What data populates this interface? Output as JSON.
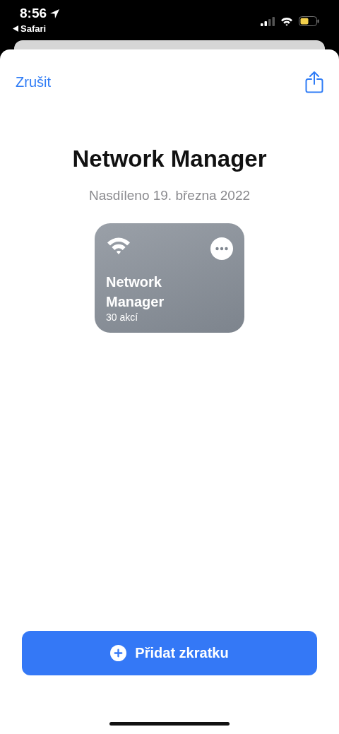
{
  "status_bar": {
    "time": "8:56",
    "back_label": "Safari"
  },
  "nav": {
    "cancel": "Zrušit"
  },
  "title": "Network Manager",
  "subtitle": "Nasdíleno 19. března 2022",
  "shortcut": {
    "name": "Network Manager",
    "actions": "30 akcí"
  },
  "add_button": "Přidat zkratku"
}
